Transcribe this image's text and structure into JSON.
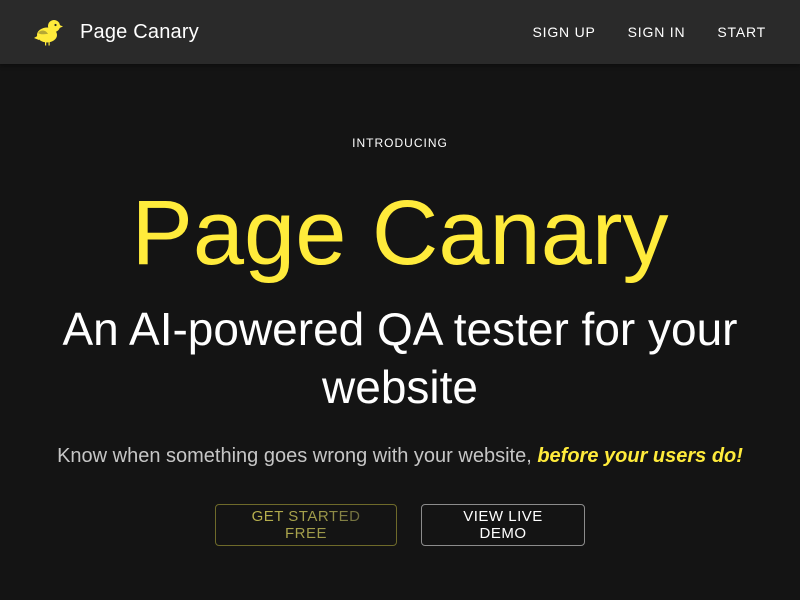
{
  "header": {
    "brand_name": "Page Canary",
    "logo_icon": "canary-bird-icon",
    "nav": [
      {
        "label": "SIGN UP"
      },
      {
        "label": "SIGN IN"
      },
      {
        "label": "START"
      }
    ]
  },
  "hero": {
    "eyebrow": "INTRODUCING",
    "title": "Page Canary",
    "subtitle": "An AI-powered QA tester for your website",
    "tagline_plain": "Know when something goes wrong with your website,",
    "tagline_emphasis": "before your users do!",
    "primary_cta": "GET STARTED FREE",
    "secondary_cta": "VIEW LIVE DEMO"
  },
  "colors": {
    "accent_yellow": "#ffeb3b",
    "topbar_bg": "#2a2a2a",
    "page_bg": "#141414",
    "muted_text": "#c6c6c6"
  }
}
